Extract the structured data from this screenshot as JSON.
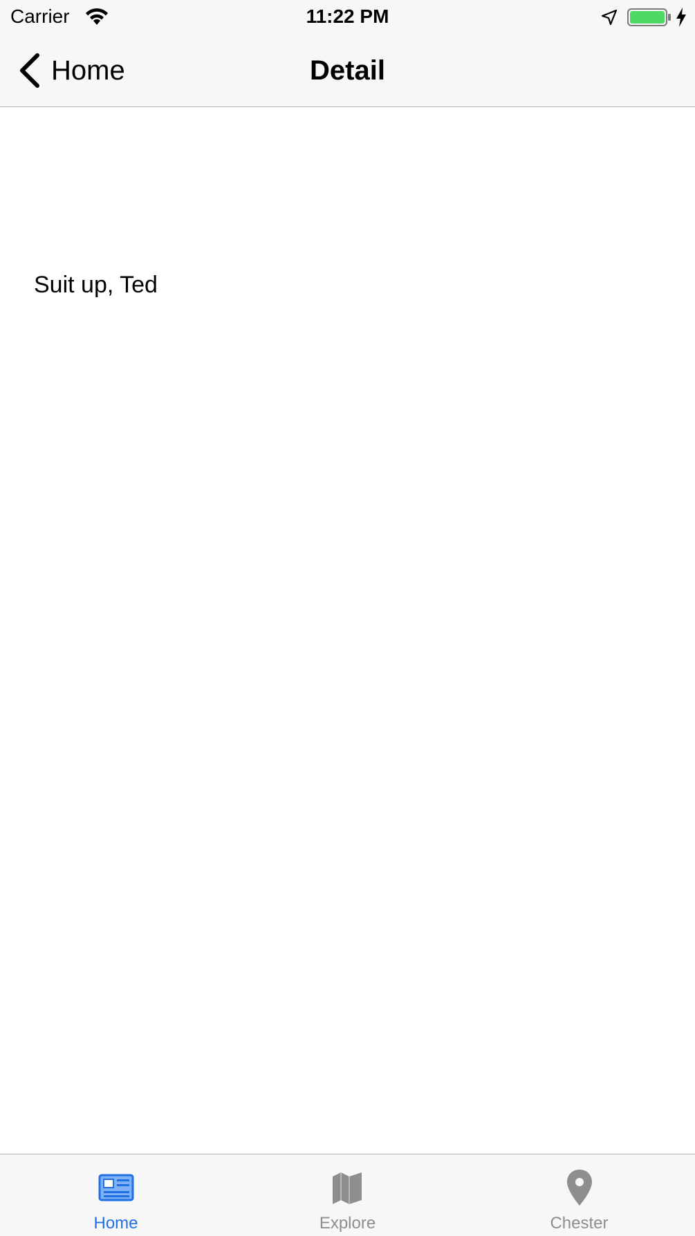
{
  "status_bar": {
    "carrier": "Carrier",
    "time": "11:22 PM",
    "battery_color": "#4cd964"
  },
  "nav_bar": {
    "back_label": "Home",
    "title": "Detail"
  },
  "content": {
    "message": "Suit up, Ted"
  },
  "tab_bar": {
    "active_color": "#1f6fe5",
    "inactive_color": "#8e8e8e",
    "tabs": [
      {
        "label": "Home",
        "icon": "newspaper-icon",
        "active": true
      },
      {
        "label": "Explore",
        "icon": "map-icon",
        "active": false
      },
      {
        "label": "Chester",
        "icon": "map-pin-icon",
        "active": false
      }
    ]
  }
}
